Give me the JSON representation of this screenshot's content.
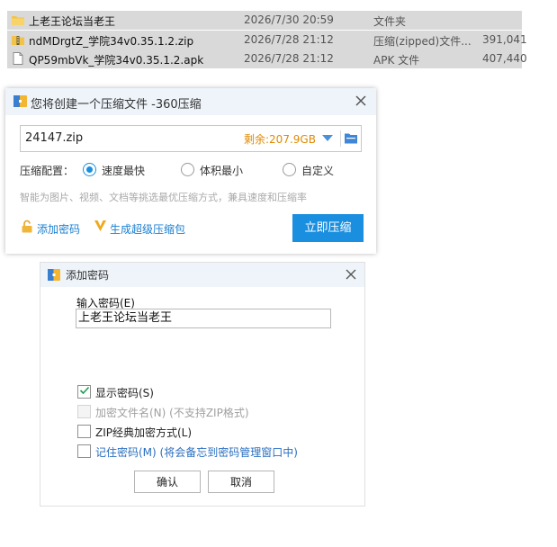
{
  "files": [
    {
      "name": "上老王论坛当老王",
      "date": "2026/7/30 20:59",
      "type": "文件夹",
      "size": "",
      "icon": "folder-icon"
    },
    {
      "name": "ndMDrgtZ_学院34v0.35.1.2.zip",
      "date": "2026/7/28 21:12",
      "type": "压缩(zipped)文件...",
      "size": "391,041",
      "icon": "zip-icon"
    },
    {
      "name": "QP59mbVk_学院34v0.35.1.2.apk",
      "date": "2026/7/28 21:12",
      "type": "APK 文件",
      "size": "407,440",
      "icon": "file-icon"
    }
  ],
  "compress_dialog": {
    "title": "您将创建一个压缩文件 -360压缩",
    "filename": "24147.zip",
    "free_space": "剩余:207.9GB",
    "config_label": "压缩配置：",
    "options": [
      "速度最快",
      "体积最小",
      "自定义"
    ],
    "selected_option": "速度最快",
    "hint": "智能为图片、视频、文档等挑选最优压缩方式，兼具速度和压缩率",
    "add_password": "添加密码",
    "super_archive": "生成超级压缩包",
    "compress_button": "立即压缩",
    "accent_color": "#1a8fe0"
  },
  "password_dialog": {
    "title": "添加密码",
    "input_label": "输入密码(E)",
    "password_value": "上老王论坛当老王",
    "options": [
      {
        "label": "显示密码(S)",
        "checked": true,
        "disabled": false
      },
      {
        "label": "加密文件名(N) (不支持ZIP格式)",
        "checked": false,
        "disabled": true
      },
      {
        "label": "ZIP经典加密方式(L)",
        "checked": false,
        "disabled": false
      },
      {
        "label": "记住密码(M) (将会备忘到密码管理窗口中)",
        "checked": false,
        "disabled": false
      }
    ],
    "ok_button": "确认",
    "cancel_button": "取消"
  }
}
